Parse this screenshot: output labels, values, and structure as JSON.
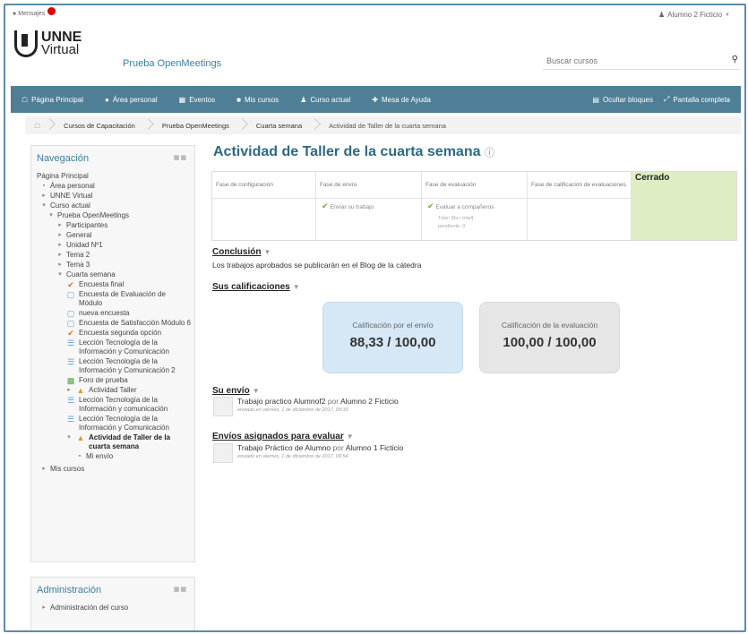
{
  "topbar": {
    "messages_label": "Mensajes",
    "user_name": "Alumno 2 Ficticio"
  },
  "header": {
    "logo_line1": "UNNE",
    "logo_line2": "Virtual",
    "site_name": "Prueba OpenMeetings",
    "search_placeholder": "Buscar cursos"
  },
  "navbar": {
    "items": [
      {
        "label": "Página Principal",
        "icon": "home-icon"
      },
      {
        "label": "Área personal",
        "icon": "dashboard-icon"
      },
      {
        "label": "Eventos",
        "icon": "calendar-icon"
      },
      {
        "label": "Mis cursos",
        "icon": "briefcase-icon"
      },
      {
        "label": "Curso actual",
        "icon": "users-icon"
      },
      {
        "label": "Mesa de Ayuda",
        "icon": "help-icon"
      }
    ],
    "hide_blocks": "Ocultar bloques",
    "fullscreen": "Pantalla completa"
  },
  "breadcrumb": [
    "Cursos de Capacitación",
    "Prueba OpenMeetings",
    "Cuarta semana",
    "Actividad de Taller de la cuarta semana"
  ],
  "nav_block": {
    "title": "Navegación",
    "items": [
      "Página Principal",
      "Área personal",
      "UNNE Virtual",
      "Curso actual",
      "Prueba OpenMeetings",
      "Participantes",
      "General",
      "Unidad Nº1",
      "Tema 2",
      "Tema 3",
      "Cuarta semana",
      "Encuesta final",
      "Encuesta de Evaluación de Módulo",
      "nueva encuesta",
      "Encuesta de Satisfacción Módulo 6",
      "Encuesta segunda opción",
      "Lección Tecnología de la Información y Comunicación",
      "Lección Tecnología de la Información y Comunicación 2",
      "Foro de prueba",
      "Actividad Taller",
      "Lección Tecnología de la Información y comunicación",
      "Lección Tecnología de la Información y Comunicación",
      "Actividad de Taller de la cuarta semana",
      "Mi envío",
      "Mis cursos"
    ]
  },
  "admin_block": {
    "title": "Administración",
    "item": "Administración del curso"
  },
  "main": {
    "title": "Actividad de Taller de la cuarta semana",
    "phases": [
      {
        "name": "Fase de configuración",
        "task": "",
        "sub1": "",
        "sub2": ""
      },
      {
        "name": "Fase de envío",
        "task": "Enviar su trabajo",
        "sub1": "",
        "sub2": ""
      },
      {
        "name": "Fase de evaluación",
        "task": "Evaluar a compañeros",
        "sub1": "Total: [8a • total]",
        "sub2": "pendiente: 0"
      },
      {
        "name": "Fase de calificación de evaluaciones",
        "task": "",
        "sub1": "",
        "sub2": ""
      },
      {
        "name": "Cerrado",
        "task": "",
        "sub1": "",
        "sub2": ""
      }
    ],
    "conclusion_title": "Conclusión",
    "conclusion_text": "Los trabajos aprobados se publicarán en el Blog de la cátedra",
    "grades_title": "Sus calificaciones",
    "grade_submission_label": "Calificación por el envío",
    "grade_submission_value": "88,33 / 100,00",
    "grade_assessment_label": "Calificación de la evaluación",
    "grade_assessment_value": "100,00 / 100,00",
    "submission_title": "Su envío",
    "submission_work": "Trabajo practico Alumnof2",
    "submission_by": "por",
    "submission_author": "Alumno 2 Ficticio",
    "submission_date": "enviado en viernes, 1 de diciembre de 2017, 09:39",
    "assigned_title": "Envíos asignados para evaluar",
    "assigned_work": "Trabajo Práctico de Alumno",
    "assigned_by": "por",
    "assigned_author": "Alumno 1 Ficticio",
    "assigned_date": "enviado en viernes, 1 de diciembre de 2017, 09:54"
  }
}
